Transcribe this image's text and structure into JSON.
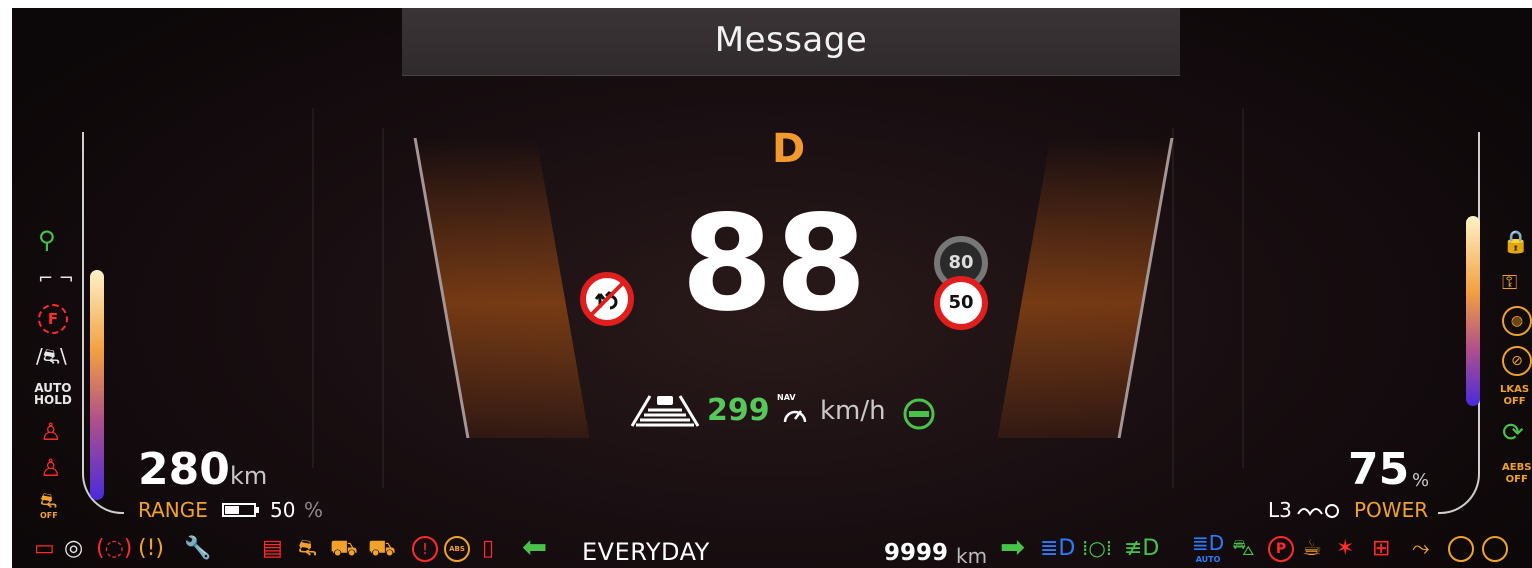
{
  "banner": {
    "title": "Message"
  },
  "center": {
    "gear": "D",
    "speed": "88",
    "speed_limit_signs": [
      "80",
      "50"
    ],
    "nav_speed_value": "299",
    "nav_badge": "NAV",
    "nav_speed_unit": "km/h"
  },
  "left_panel": {
    "range_value": "280",
    "range_unit": "km",
    "range_label": "RANGE",
    "battery_percent": "50",
    "battery_percent_unit": "%",
    "indicator_texts": [
      "AUTO",
      "HOLD",
      "OFF"
    ]
  },
  "right_panel": {
    "power_value": "75",
    "power_unit": "%",
    "power_label": "POWER",
    "power_level": "L3",
    "indicator_texts": [
      "LKAS",
      "OFF",
      "AEBS",
      "OFF"
    ]
  },
  "bottom_bar": {
    "drive_mode": "EVERYDAY",
    "odometer_value": "9999",
    "odometer_unit": "km",
    "auto_label": "AUTO"
  },
  "colors": {
    "background": "#120b0c",
    "accent_orange": "#f0a22a",
    "warning_red": "#ff2a2a",
    "ok_green": "#49c24a",
    "info_blue": "#2a7cff"
  },
  "icons": {
    "left_column": [
      "charging-plug-icon",
      "car-doors-icon",
      "fuel-filter-icon",
      "lane-assist-icon",
      "auto-hold-icon",
      "seatbelt-icon",
      "rear-seatbelt-icon",
      "traction-off-icon"
    ],
    "right_column": [
      "car-lock-icon",
      "key-icon",
      "turtle-icon",
      "steering-warning-icon",
      "lkas-off-icon",
      "regen-icon",
      "aebs-off-icon"
    ],
    "bottom_left": [
      "battery-warning-icon",
      "tpms-icon",
      "brake-pads-icon",
      "brake-warning-icon",
      "wrench-icon"
    ],
    "bottom_center": [
      "battery-hv-icon",
      "skid-icon",
      "collision-warning-icon",
      "collision-off-icon",
      "brake-fault-icon",
      "abs-icon",
      "door-open-icon",
      "turn-left-icon"
    ],
    "bottom_right": [
      "turn-right-icon",
      "high-beam-icon",
      "parking-lights-icon",
      "front-fog-icon",
      "auto-high-beam-icon",
      "car-ahead-icon",
      "parking-brake-icon",
      "driver-attention-icon",
      "airbag-icon",
      "battery-12v-icon",
      "seat-adjust-icon",
      "power-steering-icon",
      "steering-icon"
    ]
  }
}
